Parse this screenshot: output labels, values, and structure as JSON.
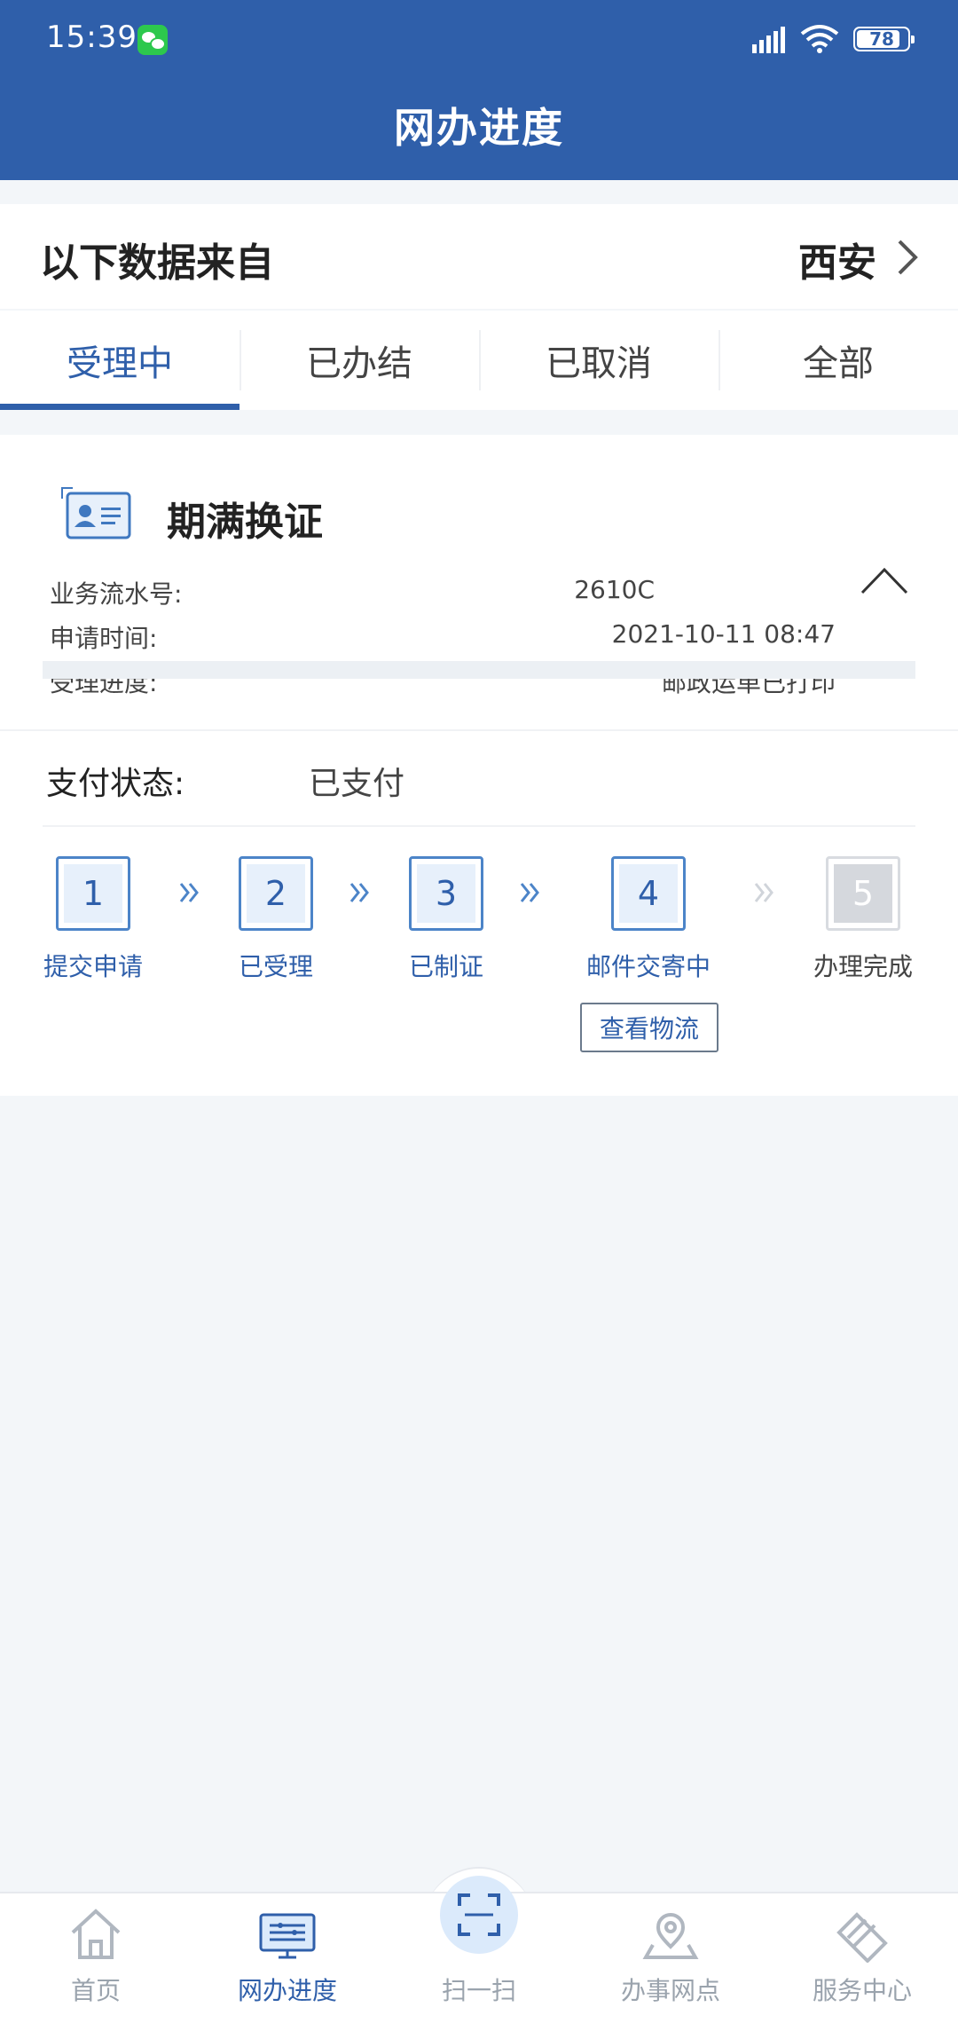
{
  "status_bar": {
    "time": "15:39",
    "battery": "78"
  },
  "header": {
    "title": "网办进度"
  },
  "location": {
    "label": "以下数据来自",
    "city": "西安"
  },
  "tabs": [
    {
      "label": "受理中",
      "active": true
    },
    {
      "label": "已办结",
      "active": false
    },
    {
      "label": "已取消",
      "active": false
    },
    {
      "label": "全部",
      "active": false
    }
  ],
  "card": {
    "title": "期满换证",
    "fields": [
      {
        "label": "业务流水号:",
        "value": "2610C"
      },
      {
        "label": "申请时间:",
        "value": "2021-10-11 08:47"
      },
      {
        "label": "受理进度:",
        "value": "邮政运单已打印"
      }
    ],
    "payment": {
      "label": "支付状态:",
      "value": "已支付"
    },
    "steps": [
      {
        "number": "1",
        "label": "提交申请",
        "done": true
      },
      {
        "number": "2",
        "label": "已受理",
        "done": true
      },
      {
        "number": "3",
        "label": "已制证",
        "done": true
      },
      {
        "number": "4",
        "label": "邮件交寄中",
        "done": true
      },
      {
        "number": "5",
        "label": "办理完成",
        "done": false
      }
    ],
    "logistics_button": "查看物流"
  },
  "nav": [
    {
      "label": "首页",
      "icon": "home-icon",
      "active": false
    },
    {
      "label": "网办进度",
      "icon": "monitor-icon",
      "active": true
    },
    {
      "label": "扫一扫",
      "icon": "scan-icon",
      "active": false
    },
    {
      "label": "办事网点",
      "icon": "map-pin-icon",
      "active": false
    },
    {
      "label": "服务中心",
      "icon": "handshake-icon",
      "active": false
    }
  ],
  "colors": {
    "primary": "#2f5faa",
    "step_active": "#4c84c8",
    "inactive": "#9aa3ad",
    "background": "#f3f6f9"
  }
}
